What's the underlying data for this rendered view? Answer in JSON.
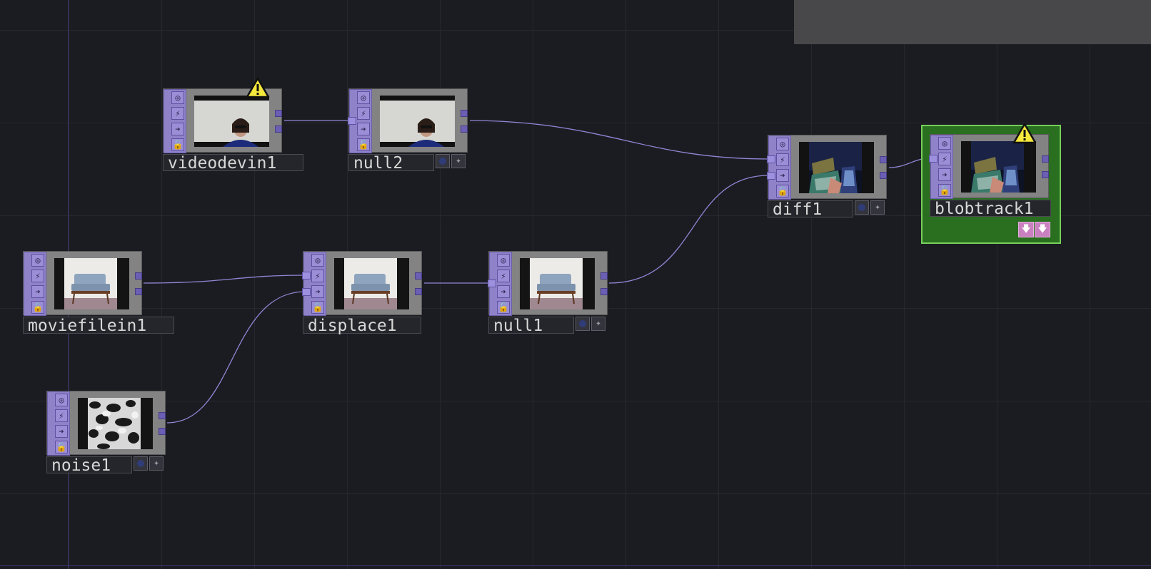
{
  "nodes": {
    "videodevin1": {
      "label": "videodevin1"
    },
    "null2": {
      "label": "null2"
    },
    "diff1": {
      "label": "diff1"
    },
    "blobtrack1": {
      "label": "blobtrack1"
    },
    "moviefilein1": {
      "label": "moviefilein1"
    },
    "displace1": {
      "label": "displace1"
    },
    "null1": {
      "label": "null1"
    },
    "noise1": {
      "label": "noise1"
    }
  },
  "colors": {
    "background": "#1b1c21",
    "node_strip": "#8f82c9",
    "wire": "#8f86d6",
    "selected": "#76d05a",
    "warning": "#f5e83c"
  }
}
